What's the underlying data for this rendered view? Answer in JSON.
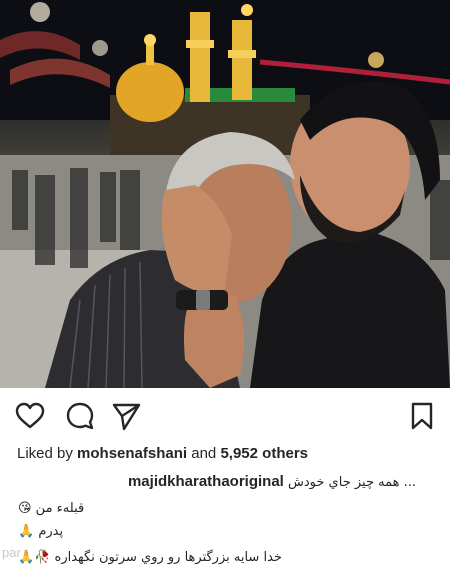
{
  "post": {
    "likes_prefix": "Liked by",
    "liked_by_user": "mohsenafshani",
    "likes_and": "and",
    "likes_others": "5,952 others",
    "caption_username": "majidkharathaoriginal",
    "caption_preview": "همه چیز جاي خودش ...",
    "caption_lines": [
      "قبله‌ء من 😘",
      "پدرم 🙏",
      "خدا سايه بزرگترها رو روي سرتون نگهداره 🥀🙏"
    ]
  },
  "icons": {
    "like": "heart-icon",
    "comment": "comment-bubble-icon",
    "share": "paper-plane-icon",
    "save": "bookmark-icon"
  },
  "watermark": "par",
  "colors": {
    "text": "#262626",
    "background": "#ffffff",
    "dome_gold": "#e3a526"
  }
}
